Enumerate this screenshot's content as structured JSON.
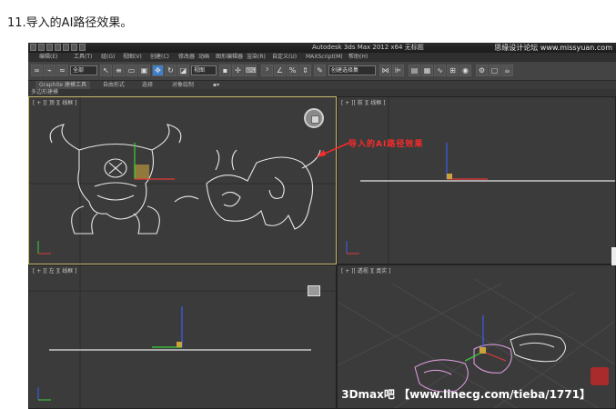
{
  "caption": "11.导入的AI路径效果。",
  "app": {
    "title": "Autodesk 3ds Max  2012 x64    无标题",
    "site": "思缘设计论坛 www.missyuan.com"
  },
  "menu": [
    "编辑(E)",
    "工具(T)",
    "组(G)",
    "视图(V)",
    "创建(C)",
    "修改器",
    "动画",
    "图形编辑器",
    "渲染(R)",
    "自定义(U)",
    "MAXScript(M)",
    "帮助(H)"
  ],
  "toolbar": {
    "filter_value": "全部",
    "view_value": "视图",
    "selection_set": "创建选择集"
  },
  "ribbon": {
    "tabs": [
      "Graphite 建模工具",
      "自由形式",
      "选择",
      "对象绘制"
    ],
    "subtitle": "多边形建模"
  },
  "viewports": {
    "top_left": "[ + ][ 顶 ][ 线框 ]",
    "top_right": "[ + ][ 前 ][ 线框 ]",
    "bottom_left": "[ + ][ 左 ][ 线框 ]",
    "bottom_right": "[ + ][ 透视 ][ 真实 ]"
  },
  "annotation": "导入的AI路径效果",
  "watermark": "3Dmax吧  【www.linecg.com/tieba/1771】",
  "colors": {
    "active_border": "#c8b86a",
    "annotation": "#ff2a2a",
    "path_stroke": "#e8e8e8",
    "perspective_path": "#e6a3e6"
  }
}
